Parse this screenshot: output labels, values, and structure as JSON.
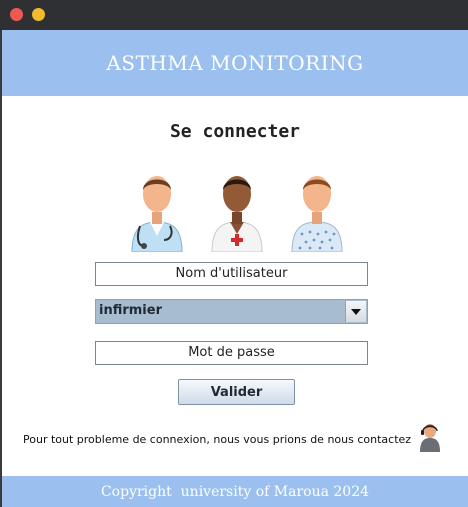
{
  "window": {
    "close_color": "#ee5a52",
    "minimize_color": "#f2bb2c"
  },
  "header": {
    "title": "ASTHMA MONITORING"
  },
  "login": {
    "title": "Se connecter",
    "avatars": [
      "doctor-icon",
      "nurse-icon",
      "patient-icon"
    ],
    "username_placeholder": "Nom d'utilisateur",
    "role_selected": "infirmier",
    "password_placeholder": "Mot de passe",
    "submit_label": "Valider"
  },
  "contact": {
    "text": "Pour tout probleme de connexion, nous vous prions de nous contactez",
    "icon": "support-person-icon"
  },
  "footer": {
    "text": "Copyright  university of Maroua 2024"
  },
  "colors": {
    "accent": "#9bc0f0",
    "select_bg": "#a8bccf"
  }
}
